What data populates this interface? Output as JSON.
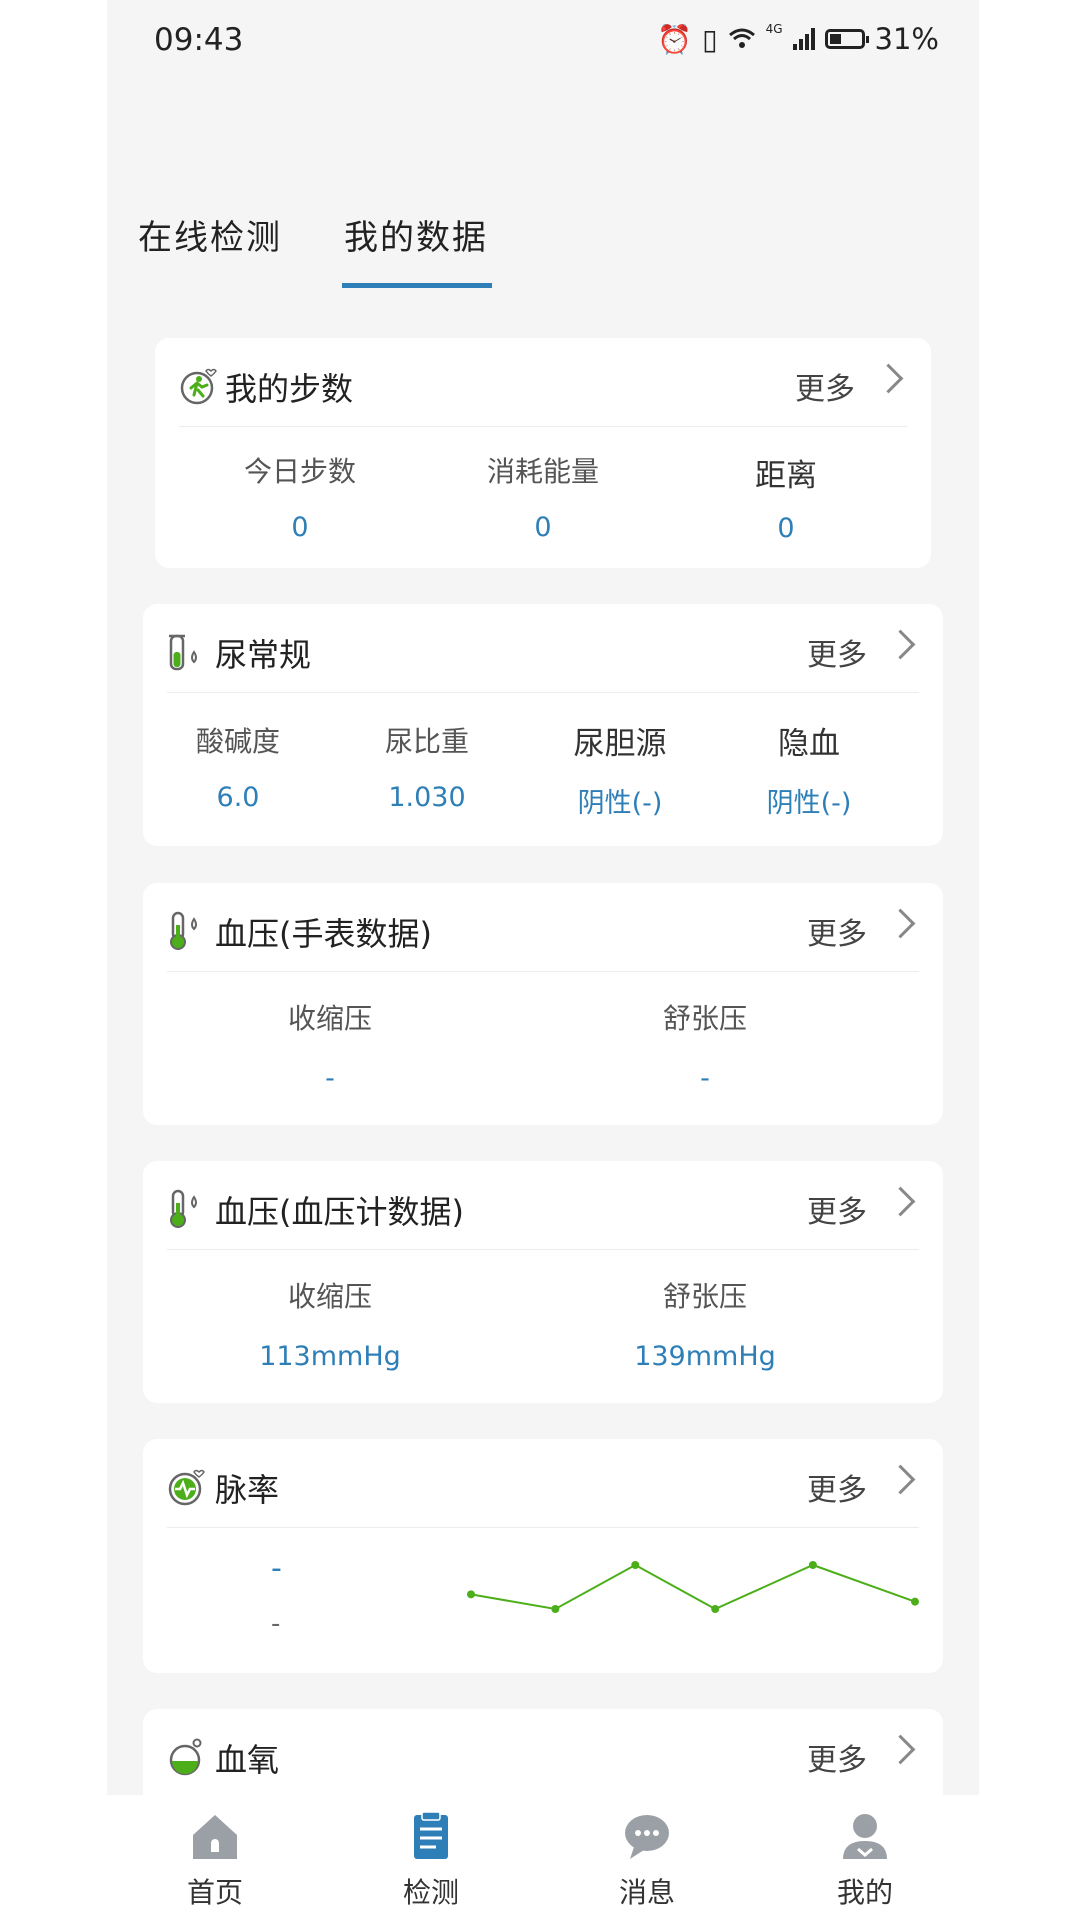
{
  "status_bar": {
    "time": "09:43",
    "battery_percent": "31%",
    "network": "4G",
    "icons": [
      "alarm-icon",
      "vibrate-icon",
      "wifi-icon",
      "signal-icon",
      "battery-icon"
    ]
  },
  "tabs": [
    {
      "label": "在线检测",
      "active": false
    },
    {
      "label": "我的数据",
      "active": true
    }
  ],
  "accent_color": "#2e7fb8",
  "chart_color": "#4caf1a",
  "more_label": "更多",
  "steps": {
    "title": "我的步数",
    "icon": "running-icon",
    "metrics": [
      {
        "label": "今日步数",
        "value": "0"
      },
      {
        "label": "消耗能量",
        "value": "0"
      },
      {
        "label": "距离",
        "value": "0"
      }
    ]
  },
  "urine": {
    "title": "尿常规",
    "icon": "test-tube-icon",
    "metrics": [
      {
        "label": "酸碱度",
        "value": "6.0"
      },
      {
        "label": "尿比重",
        "value": "1.030"
      },
      {
        "label": "尿胆源",
        "value": "阴性(-)"
      },
      {
        "label": "隐血",
        "value": "阴性(-)"
      }
    ]
  },
  "bp_watch": {
    "title": "血压(手表数据)",
    "icon": "thermometer-icon",
    "metrics": [
      {
        "label": "收缩压",
        "value": "-"
      },
      {
        "label": "舒张压",
        "value": "-"
      }
    ]
  },
  "bp_meter": {
    "title": "血压(血压计数据)",
    "icon": "thermometer-icon",
    "metrics": [
      {
        "label": "收缩压",
        "value": "113mmHg"
      },
      {
        "label": "舒张压",
        "value": "139mmHg"
      }
    ]
  },
  "pulse": {
    "title": "脉率",
    "icon": "heart-pulse-icon",
    "value_top": "-",
    "value_bottom": "-",
    "sparkline": [
      60,
      58,
      64,
      58,
      64,
      59
    ]
  },
  "spo2": {
    "title": "血氧",
    "icon": "flask-icon"
  },
  "bottom_nav": [
    {
      "label": "首页",
      "icon": "home-icon",
      "active": false
    },
    {
      "label": "检测",
      "icon": "clipboard-icon",
      "active": true
    },
    {
      "label": "消息",
      "icon": "chat-icon",
      "active": false
    },
    {
      "label": "我的",
      "icon": "user-icon",
      "active": false
    }
  ]
}
